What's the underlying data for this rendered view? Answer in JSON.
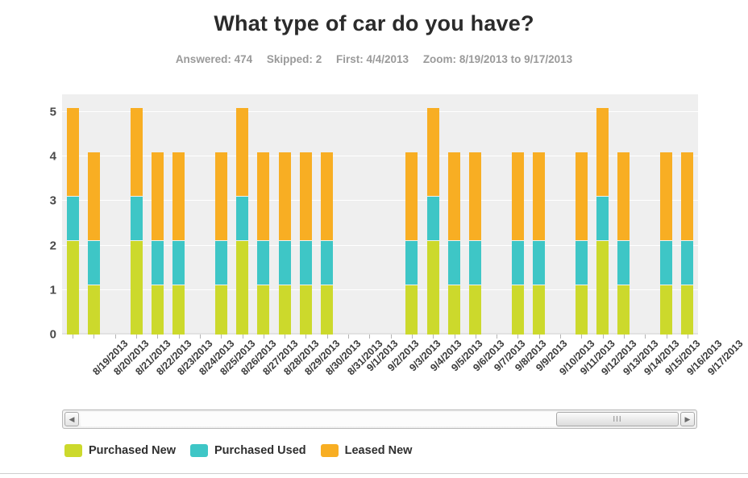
{
  "header": {
    "title": "What type of car do you have?",
    "stats": [
      {
        "label": "Answered:",
        "value": "474"
      },
      {
        "label": "Skipped:",
        "value": "2"
      },
      {
        "label": "First:",
        "value": "4/4/2013"
      },
      {
        "label": "Zoom:",
        "value": "8/19/2013 to 9/17/2013"
      }
    ]
  },
  "scrollbar": {
    "left_arrow": "◀",
    "right_arrow": "▶",
    "thumb_grip": "III"
  },
  "colors": {
    "purchased_new": "#ccd92c",
    "purchased_used": "#3ec6c6",
    "leased_new": "#f8ae23",
    "plot_background": "#efefef",
    "gridline": "#ffffff",
    "axis_text": "#4a4a4a",
    "meta_text": "#9a9a9a"
  },
  "chart_data": {
    "type": "bar",
    "title": "What type of car do you have?",
    "subtitle": "Answered: 474   Skipped: 2   First: 4/4/2013   Zoom: 8/19/2013 to 9/17/2013",
    "stacked": true,
    "xlabel": "",
    "ylabel": "",
    "ylim": [
      0,
      5.4
    ],
    "yticks": [
      0,
      1,
      2,
      3,
      4,
      5
    ],
    "grid": true,
    "legend_position": "bottom-left",
    "categories": [
      "8/19/2013",
      "8/20/2013",
      "8/21/2013",
      "8/22/2013",
      "8/23/2013",
      "8/24/2013",
      "8/25/2013",
      "8/26/2013",
      "8/27/2013",
      "8/28/2013",
      "8/29/2013",
      "8/30/2013",
      "8/31/2013",
      "9/1/2013",
      "9/2/2013",
      "9/3/2013",
      "9/4/2013",
      "9/5/2013",
      "9/6/2013",
      "9/7/2013",
      "9/8/2013",
      "9/9/2013",
      "9/10/2013",
      "9/11/2013",
      "9/12/2013",
      "9/13/2013",
      "9/14/2013",
      "9/15/2013",
      "9/16/2013",
      "9/17/2013"
    ],
    "series": [
      {
        "name": "Purchased New",
        "color": "#ccd92c",
        "values": [
          2.1,
          1.1,
          0,
          2.1,
          1.1,
          1.1,
          0,
          1.1,
          2.1,
          1.1,
          1.1,
          1.1,
          1.1,
          0,
          0,
          0,
          1.1,
          2.1,
          1.1,
          1.1,
          0,
          1.1,
          1.1,
          0,
          1.1,
          2.1,
          1.1,
          0,
          1.1,
          1.1
        ]
      },
      {
        "name": "Purchased Used",
        "color": "#3ec6c6",
        "values": [
          1.0,
          1.0,
          0,
          1.0,
          1.0,
          1.0,
          0,
          1.0,
          1.0,
          1.0,
          1.0,
          1.0,
          1.0,
          0,
          0,
          0,
          1.0,
          1.0,
          1.0,
          1.0,
          0,
          1.0,
          1.0,
          0,
          1.0,
          1.0,
          1.0,
          0,
          1.0,
          1.0
        ]
      },
      {
        "name": "Leased New",
        "color": "#f8ae23",
        "values": [
          2.0,
          2.0,
          0,
          2.0,
          2.0,
          2.0,
          0,
          2.0,
          2.0,
          2.0,
          2.0,
          2.0,
          2.0,
          0,
          0,
          0,
          2.0,
          2.0,
          2.0,
          2.0,
          0,
          2.0,
          2.0,
          0,
          2.0,
          2.0,
          2.0,
          0,
          2.0,
          2.0
        ]
      }
    ],
    "totals": [
      5.1,
      4.1,
      0,
      5.1,
      4.1,
      4.1,
      0,
      4.1,
      5.1,
      4.1,
      4.1,
      4.1,
      4.1,
      0,
      0,
      0,
      4.1,
      5.1,
      4.1,
      4.1,
      0,
      4.1,
      4.1,
      0,
      4.1,
      5.1,
      4.1,
      0,
      4.1,
      4.1
    ]
  }
}
